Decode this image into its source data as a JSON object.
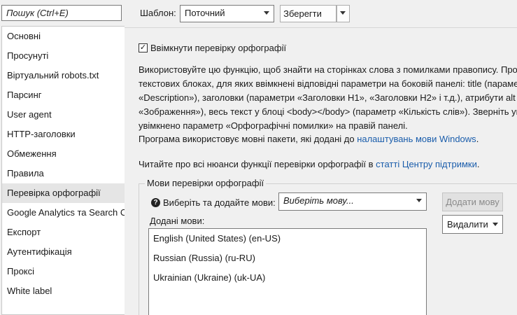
{
  "sidebar": {
    "search_placeholder": "Пошук (Ctrl+E)",
    "items": [
      {
        "label": "Основні"
      },
      {
        "label": "Просунуті"
      },
      {
        "label": "Віртуальний robots.txt"
      },
      {
        "label": "Парсинг"
      },
      {
        "label": "User agent"
      },
      {
        "label": "HTTP-заголовки"
      },
      {
        "label": "Обмеження"
      },
      {
        "label": "Правила"
      },
      {
        "label": "Перевірка орфографії",
        "active": true
      },
      {
        "label": "Google Analytics та Search Console"
      },
      {
        "label": "Експорт"
      },
      {
        "label": "Аутентифікація"
      },
      {
        "label": "Проксі"
      },
      {
        "label": "White label"
      }
    ]
  },
  "toolbar": {
    "template_label": "Шаблон:",
    "template_value": "Поточний",
    "save_label": "Зберегти"
  },
  "spellcheck": {
    "enable_label": "Ввімкнути перевірку орфографії",
    "enabled": true,
    "description_lines": [
      "Використовуйте цю функцію, щоб знайти на сторінках слова з помилками правопису. Про",
      "текстових блоках, для яких ввімкнені відповідні параметри на боковій панелі: title (параме",
      "«Description»), заголовки (параметри «Заголовки H1», «Заголовки H2» і т.д.), атрибути alt з",
      "«Зображення»), весь текст у блоці <body></body> (параметр «Кількість слів»). Зверніть ув",
      "увімкнено параметр «Орфографічні помилки» на правій панелі."
    ],
    "packs_prefix": "Програма використовує мовні пакети, які додані до ",
    "packs_link": "налаштувань мови Windows",
    "packs_suffix": ".",
    "read_prefix": "Читайте про всі нюанси функції перевірки орфографії в ",
    "read_link": "статті Центру підтримки",
    "read_suffix": "."
  },
  "languages": {
    "group_title": "Мови перевірки орфографії",
    "select_label": "Виберіть та додайте мови:",
    "select_placeholder": "Виберіть мову...",
    "add_button": "Додати мову",
    "added_label": "Додані мови:",
    "delete_button": "Видалити",
    "added": [
      {
        "label": "English (United States) (en-US)"
      },
      {
        "label": "Russian (Russia) (ru-RU)"
      },
      {
        "label": "Ukrainian (Ukraine) (uk-UA)"
      }
    ]
  }
}
